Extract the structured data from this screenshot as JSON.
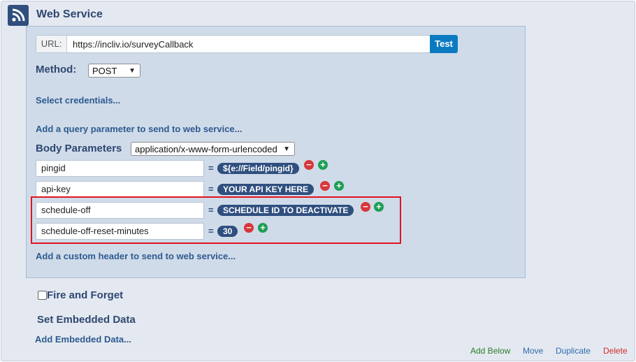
{
  "header": {
    "title": "Web Service",
    "icon": "rss-icon"
  },
  "url": {
    "label": "URL:",
    "value": "https://incliv.io/surveyCallback",
    "test_label": "Test"
  },
  "method": {
    "label": "Method:",
    "selected": "POST"
  },
  "links": {
    "select_credentials": "Select credentials...",
    "add_query_param": "Add a query parameter to send to web service...",
    "add_custom_header": "Add a custom header to send to web service...",
    "add_embedded_data": "Add Embedded Data..."
  },
  "body_params": {
    "label": "Body Parameters",
    "content_type": "application/x-www-form-urlencoded",
    "rows": [
      {
        "key": "pingid",
        "equals": "=",
        "value": "${e://Field/pingid}"
      },
      {
        "key": "api-key",
        "equals": "=",
        "value": "YOUR API KEY HERE"
      },
      {
        "key": "schedule-off",
        "equals": "=",
        "value": "SCHEDULE ID TO DEACTIVATE"
      },
      {
        "key": "schedule-off-reset-minutes",
        "equals": "=",
        "value": "30"
      }
    ]
  },
  "options": {
    "fire_and_forget": "Fire and Forget",
    "fire_and_forget_checked": false,
    "set_embedded_data": "Set Embedded Data"
  },
  "footer": {
    "add_below": "Add Below",
    "move": "Move",
    "duplicate": "Duplicate",
    "delete": "Delete"
  },
  "colors": {
    "brand": "#2e4770",
    "pill": "#2f4f7f",
    "test": "#0b7bc1",
    "highlight": "#e0141e",
    "add_below": "#2a7d2a",
    "action": "#2e6aa8",
    "delete": "#d02b2b"
  }
}
